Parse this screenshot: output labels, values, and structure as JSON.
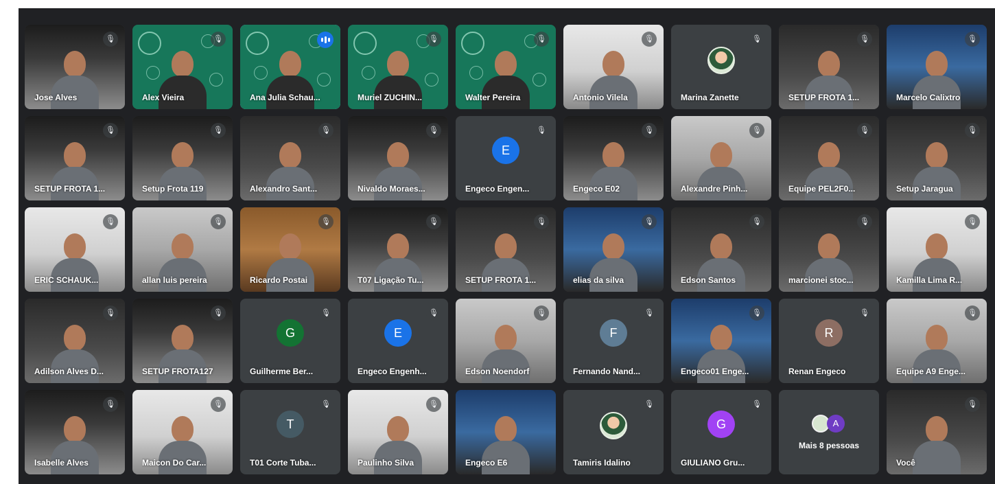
{
  "meeting": {
    "tiles": [
      {
        "name": "Jose Alves",
        "type": "video",
        "bg": "car",
        "muted": true
      },
      {
        "name": "Alex Vieira",
        "type": "slide-video",
        "bg": "green",
        "muted": true
      },
      {
        "name": "Ana Julia Schau...",
        "type": "slide-video",
        "bg": "green",
        "speaking": true
      },
      {
        "name": "Muriel ZUCHIN...",
        "type": "slide-video",
        "bg": "green",
        "muted": true
      },
      {
        "name": "Walter Pereira",
        "type": "slide-video",
        "bg": "green",
        "muted": true
      },
      {
        "name": "Antonio Vilela",
        "type": "video",
        "bg": "white",
        "muted": true
      },
      {
        "name": "Marina Zanette",
        "type": "photo-avatar",
        "muted": true
      },
      {
        "name": "SETUP FROTA 1...",
        "type": "video",
        "bg": "dark",
        "muted": true
      },
      {
        "name": "Marcelo Calixtro",
        "type": "video",
        "bg": "blue",
        "muted": true
      },
      {
        "name": "SETUP FROTA 1...",
        "type": "video",
        "bg": "car",
        "muted": true
      },
      {
        "name": "Setup Frota 119",
        "type": "video",
        "bg": "car",
        "muted": true
      },
      {
        "name": "Alexandro Sant...",
        "type": "video",
        "bg": "dark",
        "muted": true
      },
      {
        "name": "Nivaldo Moraes...",
        "type": "video",
        "bg": "car",
        "muted": true
      },
      {
        "name": "Engeco Engen...",
        "type": "letter-avatar",
        "letter": "E",
        "color": "#1a73e8",
        "muted": true
      },
      {
        "name": "Engeco E02",
        "type": "video",
        "bg": "car",
        "muted": true
      },
      {
        "name": "Alexandre Pinh...",
        "type": "video",
        "bg": "light",
        "muted": true
      },
      {
        "name": "Equipe PEL2F0...",
        "type": "video",
        "bg": "dark",
        "muted": true
      },
      {
        "name": "Setup Jaragua",
        "type": "video",
        "bg": "dark",
        "muted": true
      },
      {
        "name": "ERIC SCHAUK...",
        "type": "video",
        "bg": "white",
        "muted": true
      },
      {
        "name": "allan luis pereira",
        "type": "video",
        "bg": "light",
        "muted": true
      },
      {
        "name": "Ricardo Postai",
        "type": "video",
        "bg": "wood",
        "muted": true
      },
      {
        "name": "T07 Ligação Tu...",
        "type": "video",
        "bg": "car",
        "muted": true
      },
      {
        "name": "SETUP FROTA 1...",
        "type": "video",
        "bg": "dark",
        "muted": true
      },
      {
        "name": "elias da silva",
        "type": "video",
        "bg": "blue",
        "muted": true
      },
      {
        "name": "Edson Santos",
        "type": "video",
        "bg": "dark",
        "muted": true
      },
      {
        "name": "marcionei stoc...",
        "type": "video",
        "bg": "dark",
        "muted": true
      },
      {
        "name": "Kamilla Lima R...",
        "type": "video",
        "bg": "white",
        "muted": true
      },
      {
        "name": "Adilson Alves D...",
        "type": "video",
        "bg": "dark",
        "muted": true
      },
      {
        "name": "SETUP FROTA127",
        "type": "video",
        "bg": "car",
        "muted": true
      },
      {
        "name": "Guilherme Ber...",
        "type": "letter-avatar",
        "letter": "G",
        "color": "#137333",
        "muted": true
      },
      {
        "name": "Engeco Engenh...",
        "type": "letter-avatar",
        "letter": "E",
        "color": "#1a73e8",
        "muted": true
      },
      {
        "name": "Edson Noendorf",
        "type": "video",
        "bg": "light",
        "muted": true
      },
      {
        "name": "Fernando Nand...",
        "type": "letter-avatar",
        "letter": "F",
        "color": "#5f7d95",
        "muted": true
      },
      {
        "name": "Engeco01 Enge...",
        "type": "video",
        "bg": "blue",
        "muted": true
      },
      {
        "name": "Renan Engeco",
        "type": "letter-avatar",
        "letter": "R",
        "color": "#8d6e63",
        "muted": true
      },
      {
        "name": "Equipe A9 Enge...",
        "type": "video",
        "bg": "light",
        "muted": true
      },
      {
        "name": "Isabelle Alves",
        "type": "video",
        "bg": "car",
        "muted": true
      },
      {
        "name": "Maicon Do Car...",
        "type": "video",
        "bg": "white",
        "muted": true
      },
      {
        "name": "T01 Corte Tuba...",
        "type": "letter-avatar",
        "letter": "T",
        "color": "#455a64",
        "muted": true
      },
      {
        "name": "Paulinho Silva",
        "type": "video",
        "bg": "white",
        "muted": true
      },
      {
        "name": "Engeco E6",
        "type": "video",
        "bg": "blue",
        "muted": false
      },
      {
        "name": "Tamiris Idalino",
        "type": "photo-avatar",
        "muted": true
      },
      {
        "name": "GIULIANO Gru...",
        "type": "letter-avatar",
        "letter": "G",
        "color": "#a142f4",
        "muted": true
      },
      {
        "name": "Mais 8 pessoas",
        "type": "more",
        "letter": "A",
        "muted": false
      },
      {
        "name": "Você",
        "type": "video",
        "bg": "dark",
        "muted": true
      }
    ]
  }
}
